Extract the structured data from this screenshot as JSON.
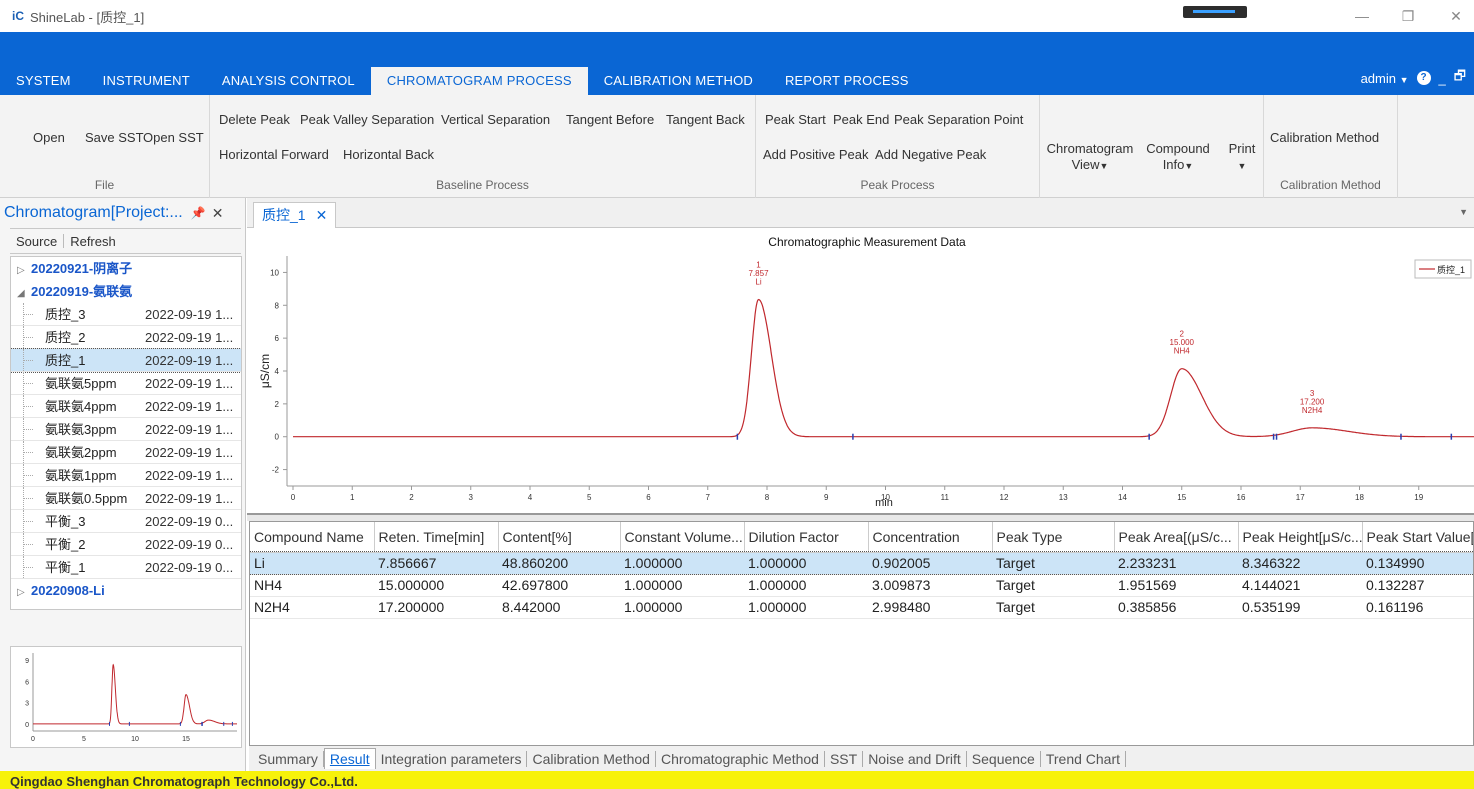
{
  "titlebar": {
    "logo": "iC",
    "title": "ShineLab - [质控_1]"
  },
  "menu": {
    "tabs": [
      "SYSTEM",
      "INSTRUMENT",
      "ANALYSIS CONTROL",
      "CHROMATOGRAM PROCESS",
      "CALIBRATION METHOD",
      "REPORT PROCESS"
    ],
    "active_index": 3,
    "user": "admin"
  },
  "ribbon": {
    "file": {
      "caption": "File",
      "open": "Open",
      "save_sst": "Save SST",
      "open_sst": "Open SST"
    },
    "baseline": {
      "caption": "Baseline Process",
      "delete_peak": "Delete Peak",
      "peak_valley": "Peak Valley Separation",
      "vertical": "Vertical Separation",
      "tangent_before": "Tangent Before",
      "tangent_back": "Tangent Back",
      "horizontal_forward": "Horizontal Forward",
      "horizontal_back": "Horizontal Back"
    },
    "peak": {
      "caption": "Peak Process",
      "peak_start": "Peak Start",
      "peak_end": "Peak End",
      "separation_point": "Peak Separation Point",
      "add_positive": "Add Positive Peak",
      "add_negative": "Add Negative Peak"
    },
    "view": {
      "chromatogram_1": "Chromatogram",
      "chromatogram_2": "View",
      "compound_1": "Compound",
      "compound_2": "Info",
      "print": "Print"
    },
    "calibration": {
      "button": "Calibration Method",
      "caption": "Calibration Method"
    }
  },
  "left_panel": {
    "title": "Chromatogram[Project:...",
    "tools": {
      "source": "Source",
      "refresh": "Refresh"
    },
    "tree": {
      "group1": "20220921-阴离子",
      "group2": "20220919-氨联氨",
      "items": [
        {
          "name": "质控_3",
          "date": "2022-09-19 1..."
        },
        {
          "name": "质控_2",
          "date": "2022-09-19 1..."
        },
        {
          "name": "质控_1",
          "date": "2022-09-19 1..."
        },
        {
          "name": "氨联氨5ppm",
          "date": "2022-09-19 1..."
        },
        {
          "name": "氨联氨4ppm",
          "date": "2022-09-19 1..."
        },
        {
          "name": "氨联氨3ppm",
          "date": "2022-09-19 1..."
        },
        {
          "name": "氨联氨2ppm",
          "date": "2022-09-19 1..."
        },
        {
          "name": "氨联氨1ppm",
          "date": "2022-09-19 1..."
        },
        {
          "name": "氨联氨0.5ppm",
          "date": "2022-09-19 1..."
        },
        {
          "name": "平衡_3",
          "date": "2022-09-19 0..."
        },
        {
          "name": "平衡_2",
          "date": "2022-09-19 0..."
        },
        {
          "name": "平衡_1",
          "date": "2022-09-19 0..."
        }
      ],
      "selected_index": 2,
      "group3": "20220908-Li"
    },
    "mini_chart": {
      "yticks": [
        "9",
        "6",
        "3",
        "0"
      ],
      "xticks": [
        "0",
        "5",
        "10",
        "15"
      ]
    }
  },
  "doc_tab": {
    "label": "质控_1"
  },
  "chart_data": {
    "type": "line",
    "title": "Chromatographic Measurement Data",
    "xlabel": "min",
    "ylabel": "μS/cm",
    "xlim": [
      0,
      20
    ],
    "ylim": [
      -3,
      11
    ],
    "xticks": [
      "0",
      "1",
      "2",
      "3",
      "4",
      "5",
      "6",
      "7",
      "8",
      "9",
      "10",
      "11",
      "12",
      "13",
      "14",
      "15",
      "16",
      "17",
      "18",
      "19"
    ],
    "yticks": [
      "10",
      "8",
      "6",
      "4",
      "2",
      "0",
      "-2"
    ],
    "legend": "top-right",
    "color": "#c0282d",
    "series": [
      {
        "name": "质控_1"
      }
    ],
    "peaks": [
      {
        "num": "1",
        "rt": "7.857",
        "label": "Li",
        "x": 7.857,
        "height": 8.35,
        "width": 0.16
      },
      {
        "num": "2",
        "rt": "15.000",
        "label": "NH4",
        "x": 15.0,
        "height": 4.14,
        "width": 0.25
      },
      {
        "num": "3",
        "rt": "17.200",
        "label": "N2H4",
        "x": 17.2,
        "height": 0.54,
        "width": 0.45
      }
    ],
    "baseline_marks": [
      7.5,
      9.45,
      14.45,
      16.55,
      16.6,
      18.7,
      19.55
    ]
  },
  "table": {
    "headers": [
      "Compound Name",
      "Reten. Time[min]",
      "Content[%]",
      "Constant Volume...",
      "Dilution Factor",
      "Concentration",
      "Peak Type",
      "Peak Area[(μS/c...",
      "Peak Height[μS/c...",
      "Peak Start Value[..."
    ],
    "rows": [
      [
        "Li",
        "7.856667",
        "48.860200",
        "1.000000",
        "1.000000",
        "0.902005",
        "Target",
        "2.233231",
        "8.346322",
        "0.134990"
      ],
      [
        "NH4",
        "15.000000",
        "42.697800",
        "1.000000",
        "1.000000",
        "3.009873",
        "Target",
        "1.951569",
        "4.144021",
        "0.132287"
      ],
      [
        "N2H4",
        "17.200000",
        "8.442000",
        "1.000000",
        "1.000000",
        "2.998480",
        "Target",
        "0.385856",
        "0.535199",
        "0.161196"
      ]
    ],
    "selected_row": 0
  },
  "bottom_tabs": [
    "Summary",
    "Result",
    "Integration parameters",
    "Calibration Method",
    "Chromatographic Method",
    "SST",
    "Noise and Drift",
    "Sequence",
    "Trend Chart"
  ],
  "bottom_tab_active": 1,
  "status": "Qingdao Shenghan Chromatograph Technology Co.,Ltd."
}
